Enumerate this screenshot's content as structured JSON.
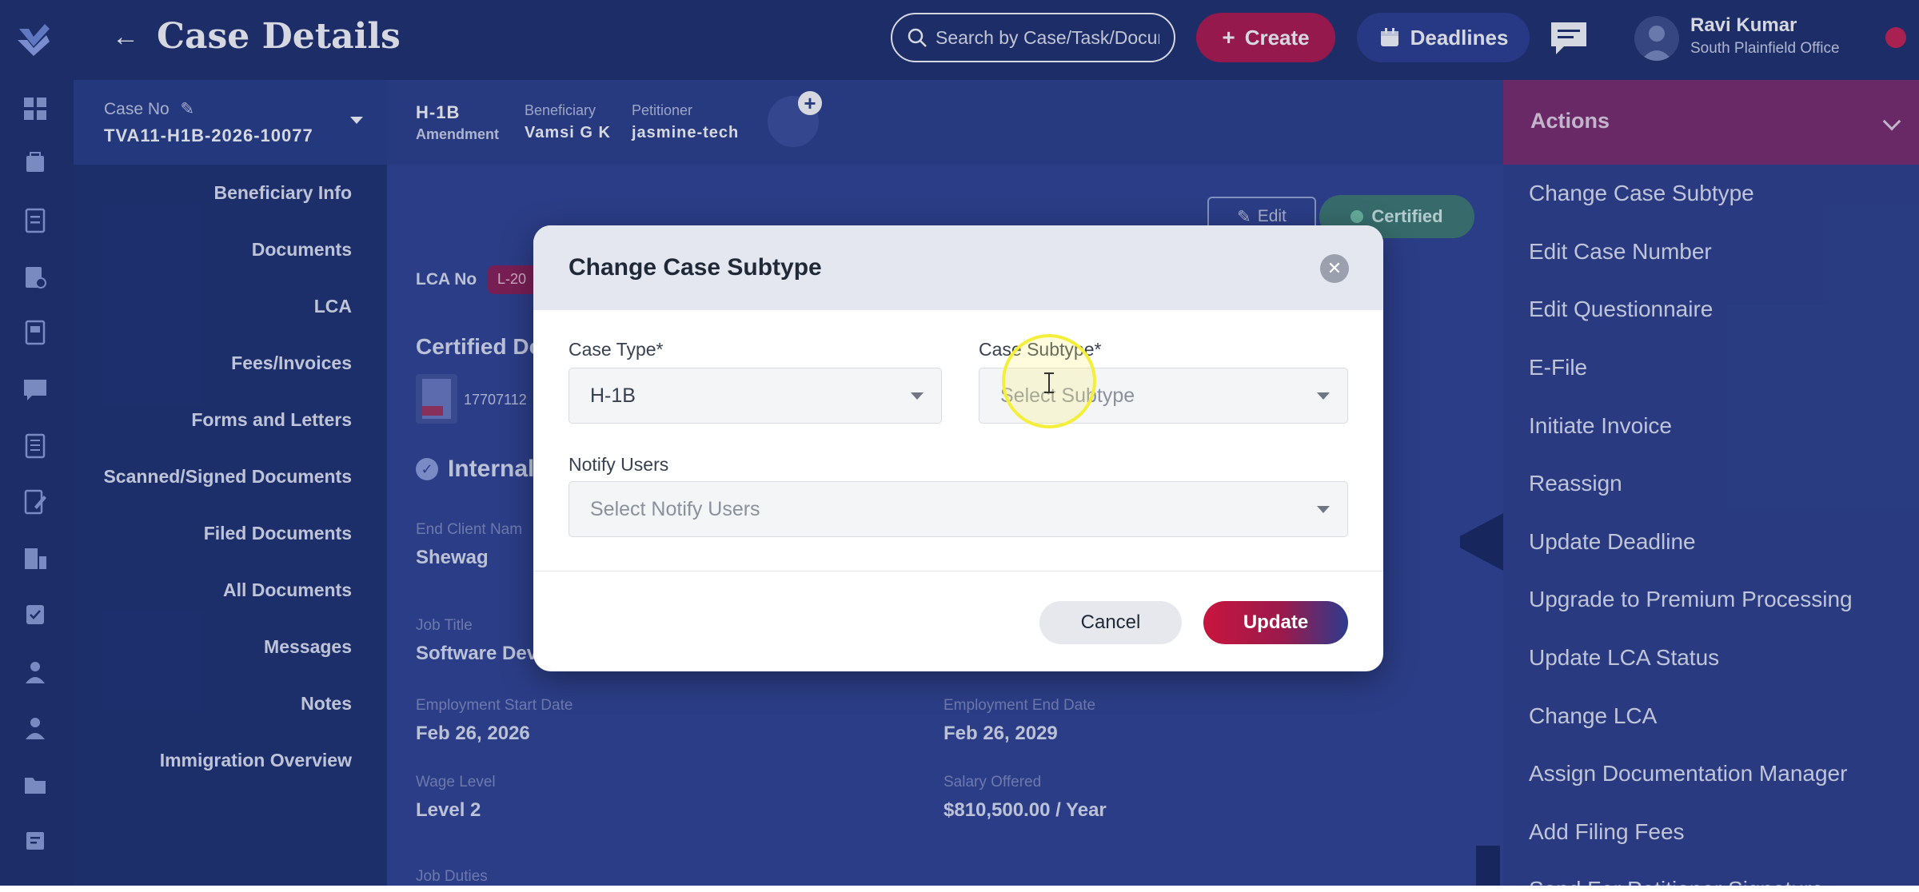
{
  "header": {
    "back_icon": "back-arrow-icon",
    "title": "Case Details",
    "search_placeholder": "Search by Case/Task/Document",
    "create_label": "Create",
    "deadlines_label": "Deadlines",
    "user_name": "Ravi Kumar",
    "user_office": "South Plainfield Office"
  },
  "case_nav": {
    "case_no_label": "Case No",
    "case_no_value": "TVA11-H1B-2026-10077",
    "items": [
      {
        "label": "Beneficiary Info"
      },
      {
        "label": "Documents"
      },
      {
        "label": "LCA"
      },
      {
        "label": "Fees/Invoices"
      },
      {
        "label": "Forms and Letters"
      },
      {
        "label": "Scanned/Signed Documents"
      },
      {
        "label": "Filed Documents"
      },
      {
        "label": "All Documents"
      },
      {
        "label": "Messages"
      },
      {
        "label": "Notes"
      },
      {
        "label": "Immigration Overview"
      }
    ]
  },
  "case_strip": {
    "type": "H-1B",
    "subtype": "Amendment",
    "beneficiary_label": "Beneficiary",
    "beneficiary_value": "Vamsi G K",
    "petitioner_label": "Petitioner",
    "petitioner_value": "jasmine-tech"
  },
  "main": {
    "edit_label": "Edit",
    "status_badge": "Certified",
    "lca_no_label": "LCA No",
    "lca_chip": "L-20",
    "certified_title": "Certified Do",
    "file_name": "17707112",
    "internal_title": "Internal",
    "fields": {
      "end_client_label": "End Client Nam",
      "end_client_value": "Shewag",
      "job_title_label": "Job Title",
      "job_title_value": "Software Dev",
      "start_date_label": "Employment Start Date",
      "start_date_value": "Feb 26, 2026",
      "end_date_label": "Employment End Date",
      "end_date_value": "Feb 26, 2029",
      "wage_level_label": "Wage Level",
      "wage_level_value": "Level 2",
      "salary_label": "Salary Offered",
      "salary_value": "$810,500.00 / Year",
      "job_duties_label": "Job Duties"
    }
  },
  "actions": {
    "title": "Actions",
    "items": [
      {
        "label": "Change Case Subtype"
      },
      {
        "label": "Edit Case Number"
      },
      {
        "label": "Edit Questionnaire"
      },
      {
        "label": "E-File"
      },
      {
        "label": "Initiate Invoice"
      },
      {
        "label": "Reassign"
      },
      {
        "label": "Update Deadline"
      },
      {
        "label": "Upgrade to Premium Processing"
      },
      {
        "label": "Update LCA Status"
      },
      {
        "label": "Change LCA"
      },
      {
        "label": "Assign Documentation Manager"
      },
      {
        "label": "Add Filing Fees"
      },
      {
        "label": "Send For Petitioner Signature"
      }
    ]
  },
  "modal": {
    "title": "Change Case Subtype",
    "case_type_label": "Case Type*",
    "case_type_value": "H-1B",
    "case_subtype_label": "Case Subtype*",
    "case_subtype_placeholder": "Select Subtype",
    "notify_label": "Notify Users",
    "notify_placeholder": "Select Notify Users",
    "cancel_label": "Cancel",
    "update_label": "Update"
  },
  "colors": {
    "primary_navy": "#1e2f6b",
    "accent_red": "#c8153e",
    "status_green": "#3d7a6f"
  }
}
